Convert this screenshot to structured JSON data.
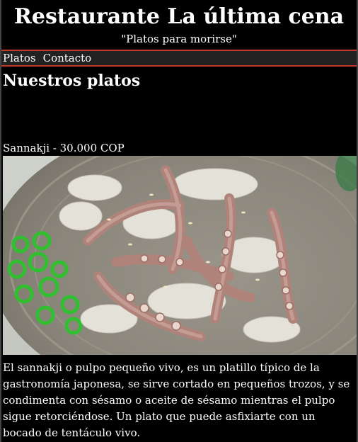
{
  "header": {
    "title": "Restaurante La última cena",
    "subtitle": "\"Platos para morirse\""
  },
  "nav": {
    "items": [
      {
        "label": "Platos"
      },
      {
        "label": "Contacto"
      }
    ]
  },
  "main": {
    "section_title": "Nuestros platos",
    "dishes": [
      {
        "caption": "Sannakji - 30.000 COP",
        "description": "El sannakji o pulpo pequeño vivo, es un platillo típico de la gastronomía japonesa, se sirve cortado en pequeños trozos, y se condimenta con sésamo o aceite de sésamo mientras el pulpo sigue retorciéndose. Un plato que puede asfixiarte con un bocado de tentáculo vivo."
      }
    ]
  }
}
